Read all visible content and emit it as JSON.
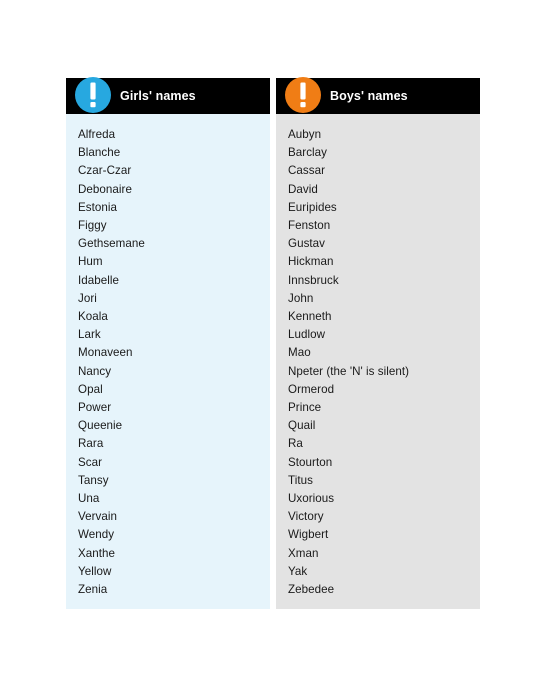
{
  "page": {
    "background": "#ffffff"
  },
  "columns": [
    {
      "id": "girls",
      "title": "Girls' names",
      "icon": "exclamation-circle-icon",
      "icon_color": "#27a8e0",
      "header_background": "#000000",
      "panel_background": "#e6f4fb",
      "names": [
        "Alfreda",
        "Blanche",
        "Czar-Czar",
        "Debonaire",
        "Estonia",
        "Figgy",
        "Gethsemane",
        "Hum",
        "Idabelle",
        "Jori",
        "Koala",
        "Lark",
        "Monaveen",
        "Nancy",
        "Opal",
        "Power",
        "Queenie",
        "Rara",
        "Scar",
        "Tansy",
        "Una",
        "Vervain",
        "Wendy",
        "Xanthe",
        "Yellow",
        "Zenia"
      ]
    },
    {
      "id": "boys",
      "title": "Boys' names",
      "icon": "exclamation-circle-icon",
      "icon_color": "#f07d15",
      "header_background": "#000000",
      "panel_background": "#e3e3e3",
      "names": [
        "Aubyn",
        "Barclay",
        "Cassar",
        "David",
        "Euripides",
        "Fenston",
        "Gustav",
        "Hickman",
        "Innsbruck",
        "John",
        "Kenneth",
        "Ludlow",
        "Mao",
        "Npeter (the 'N' is silent)",
        "Ormerod",
        "Prince",
        "Quail",
        "Ra",
        "Stourton",
        "Titus",
        "Uxorious",
        "Victory",
        "Wigbert",
        "Xman",
        "Yak",
        "Zebedee"
      ]
    }
  ]
}
